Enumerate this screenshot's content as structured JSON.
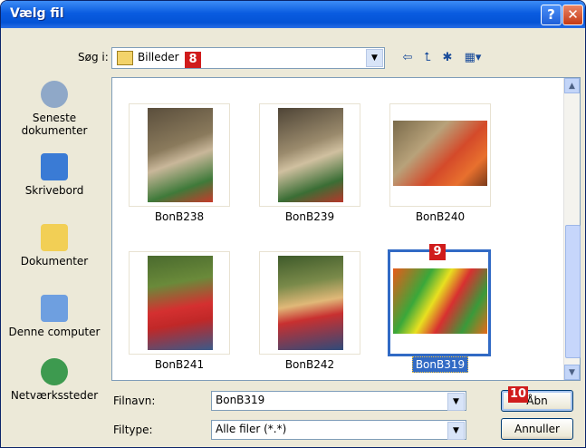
{
  "window": {
    "title": "Vælg fil",
    "help_glyph": "?",
    "close_glyph": "✕"
  },
  "toolbar": {
    "lookin_label": "Søg i:",
    "lookin_value": "Billeder",
    "lookin_badge": "8",
    "back_glyph": "⇦",
    "up_glyph": "⮤",
    "newfolder_glyph": "✱",
    "views_glyph": "▦▾",
    "dropdown_glyph": "▼"
  },
  "places": [
    {
      "label": "Seneste dokumenter",
      "icon": "recent-documents-icon"
    },
    {
      "label": "Skrivebord",
      "icon": "desktop-icon"
    },
    {
      "label": "Dokumenter",
      "icon": "my-documents-icon"
    },
    {
      "label": "Denne computer",
      "icon": "my-computer-icon"
    },
    {
      "label": "Netværkssteder",
      "icon": "network-places-icon"
    }
  ],
  "files": [
    {
      "name": "BonB238",
      "orientation": "portrait"
    },
    {
      "name": "BonB239",
      "orientation": "portrait"
    },
    {
      "name": "BonB240",
      "orientation": "landscape"
    },
    {
      "name": "BonB241",
      "orientation": "portrait"
    },
    {
      "name": "BonB242",
      "orientation": "portrait"
    },
    {
      "name": "BonB319",
      "orientation": "landscape",
      "selected": true,
      "badge": "9"
    }
  ],
  "scrollbar": {
    "up_glyph": "▲",
    "down_glyph": "▼"
  },
  "filename": {
    "label": "Filnavn:",
    "value": "BonB319"
  },
  "filetype": {
    "label": "Filtype:",
    "value": "Alle filer (*.*)"
  },
  "buttons": {
    "open": "Åbn",
    "open_badge": "10",
    "cancel": "Annuller"
  }
}
